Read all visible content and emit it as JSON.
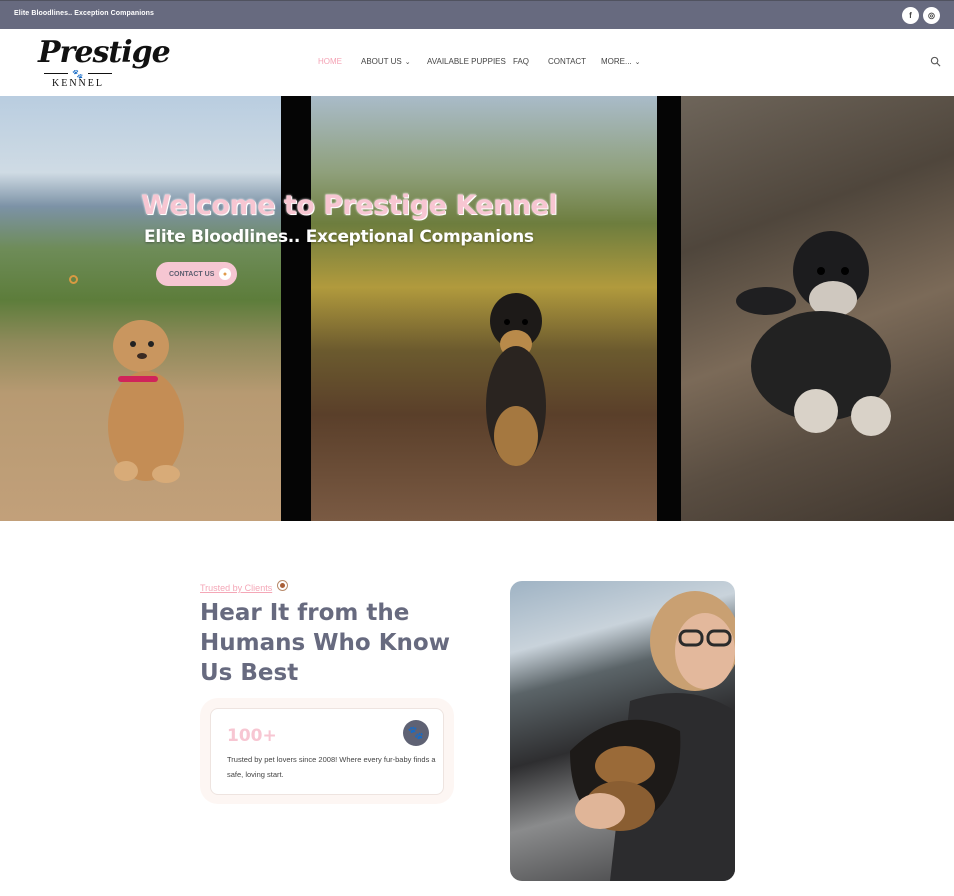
{
  "topbar": {
    "tagline": "Elite Bloodlines.. Exception Companions",
    "social": [
      {
        "icon": "facebook-icon",
        "glyph": "f"
      },
      {
        "icon": "instagram-icon",
        "glyph": "◎"
      }
    ]
  },
  "header": {
    "logo": {
      "script": "Prestige",
      "sub": "KENNEL"
    },
    "nav": [
      {
        "label": "HOME",
        "active": true
      },
      {
        "label": "ABOUT US",
        "dropdown": true
      },
      {
        "label": "AVAILABLE PUPPIES"
      },
      {
        "label": "FAQ"
      },
      {
        "label": "CONTACT"
      },
      {
        "label": "MORE...",
        "dropdown": true
      }
    ],
    "search_icon": "search-icon"
  },
  "hero": {
    "title": "Welcome to Prestige Kennel",
    "subtitle": "Elite Bloodlines.. Exceptional Companions",
    "button_label": "CONTACT US"
  },
  "testimonials": {
    "eyebrow": "Trusted by Clients",
    "heading": "Hear It from the Humans Who Know Us Best",
    "stat": "100+",
    "stat_text": "Trusted by pet lovers since 2008! Where every fur-baby finds a safe, loving start."
  },
  "colors": {
    "topbar": "#676a7f",
    "accent_pink": "#f7c6d2",
    "heading": "#676a7f",
    "nav_active": "#f4a2b4"
  }
}
